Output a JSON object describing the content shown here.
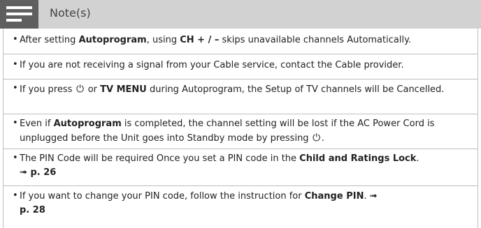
{
  "header": {
    "title": "Note(s)",
    "icon": "notes-menu-icon"
  },
  "notes": [
    {
      "parts": [
        {
          "t": "After setting ",
          "b": false
        },
        {
          "t": "Autoprogram",
          "b": true
        },
        {
          "t": ", using ",
          "b": false
        },
        {
          "t": "CH + / –",
          "b": true
        },
        {
          "t": " skips unavailable channels Automatically.",
          "b": false
        }
      ]
    },
    {
      "parts": [
        {
          "t": "If you are not receiving a signal from your Cable service, contact the Cable provider.",
          "b": false
        }
      ]
    },
    {
      "parts": [
        {
          "t": "If you press ",
          "b": false
        },
        {
          "t": "⏻",
          "b": false,
          "icon": "power-icon"
        },
        {
          "t": " or ",
          "b": false
        },
        {
          "t": "TV MENU",
          "b": true
        },
        {
          "t": " during Autoprogram, the Setup of TV channels will be Cancelled.",
          "b": false
        }
      ]
    },
    {
      "parts": [
        {
          "t": "Even if ",
          "b": false
        },
        {
          "t": "Autoprogram",
          "b": true
        },
        {
          "t": " is completed, the channel setting will be lost if the AC Power Cord is unplugged before the Unit goes into Standby mode by pressing ",
          "b": false
        },
        {
          "t": "⏻",
          "b": false,
          "icon": "power-icon"
        },
        {
          "t": ".",
          "b": false
        }
      ]
    },
    {
      "parts": [
        {
          "t": "The PIN Code will be required Once you set a PIN code in the ",
          "b": false
        },
        {
          "t": "Child and Ratings Lock",
          "b": true
        },
        {
          "t": ". ",
          "b": false
        }
      ],
      "ref": {
        "arrow": "➟",
        "page": "p. 26"
      }
    },
    {
      "parts": [
        {
          "t": "If you want to change your PIN code, follow the instruction for ",
          "b": false
        },
        {
          "t": "Change PIN",
          "b": true
        },
        {
          "t": ". ",
          "b": false
        }
      ],
      "ref": {
        "arrow": "➟",
        "page": "p. 28"
      }
    }
  ],
  "bullet_char": "•"
}
